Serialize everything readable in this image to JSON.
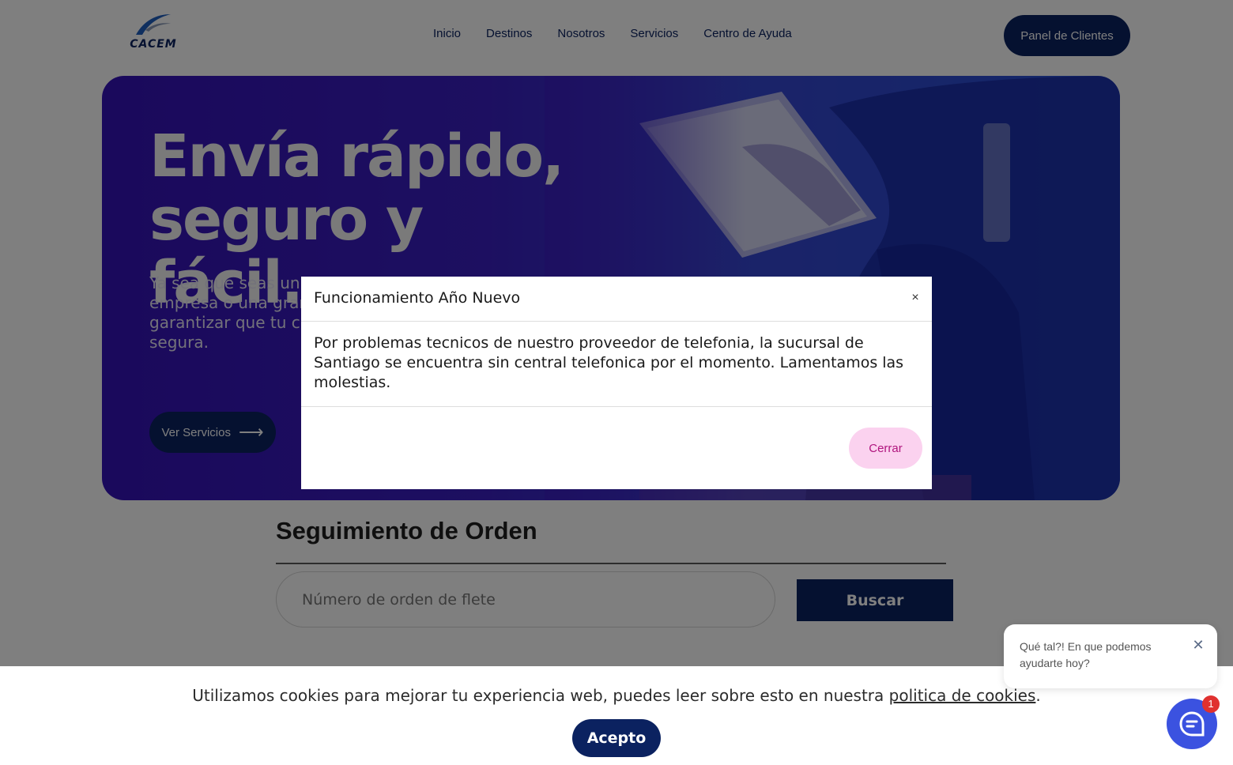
{
  "header": {
    "logo_text": "CACEM",
    "nav": [
      {
        "label": "Inicio"
      },
      {
        "label": "Destinos"
      },
      {
        "label": "Nosotros"
      },
      {
        "label": "Servicios"
      },
      {
        "label": "Centro de Ayuda"
      }
    ],
    "panel_button": "Panel de Clientes"
  },
  "hero": {
    "title_line1": "Envía rápido,",
    "title_line2": "seguro y fácil.",
    "subtitle_lines": [
      "Ya sea que seas un",
      "empresa o una gran",
      "garantizar que tu ca",
      "segura."
    ],
    "button_label": "Ver Servicios",
    "arrow_icon": "arrow-right-icon"
  },
  "tracking": {
    "title": "Seguimiento de Orden",
    "placeholder": "Número de orden de flete",
    "button_label": "Buscar"
  },
  "modal": {
    "title": "Funcionamiento Año Nuevo",
    "close_glyph": "×",
    "body": "Por problemas tecnicos de nuestro proveedor de telefonia, la sucursal de Santiago se encuentra sin central telefonica por el momento. Lamentamos las molestias.",
    "close_button": "Cerrar"
  },
  "cookies": {
    "text": "Utilizamos cookies para mejorar tu experiencia web, puedes leer sobre esto en nuestra ",
    "link": "politica de cookies",
    "suffix": ".",
    "accept_button": "Acepto"
  },
  "chat": {
    "bubble_text": "Qué tal?! En que podemos ayudarte hoy?",
    "close_glyph": "✕",
    "badge_count": "1",
    "launcher_icon": "chat-icon"
  },
  "colors": {
    "brand_navy": "#0b2260",
    "hero_purple": "#3512b8",
    "cerrar_pink": "#fbd2ef",
    "chat_blue": "#3b52e0",
    "badge_red": "#e0312f"
  }
}
